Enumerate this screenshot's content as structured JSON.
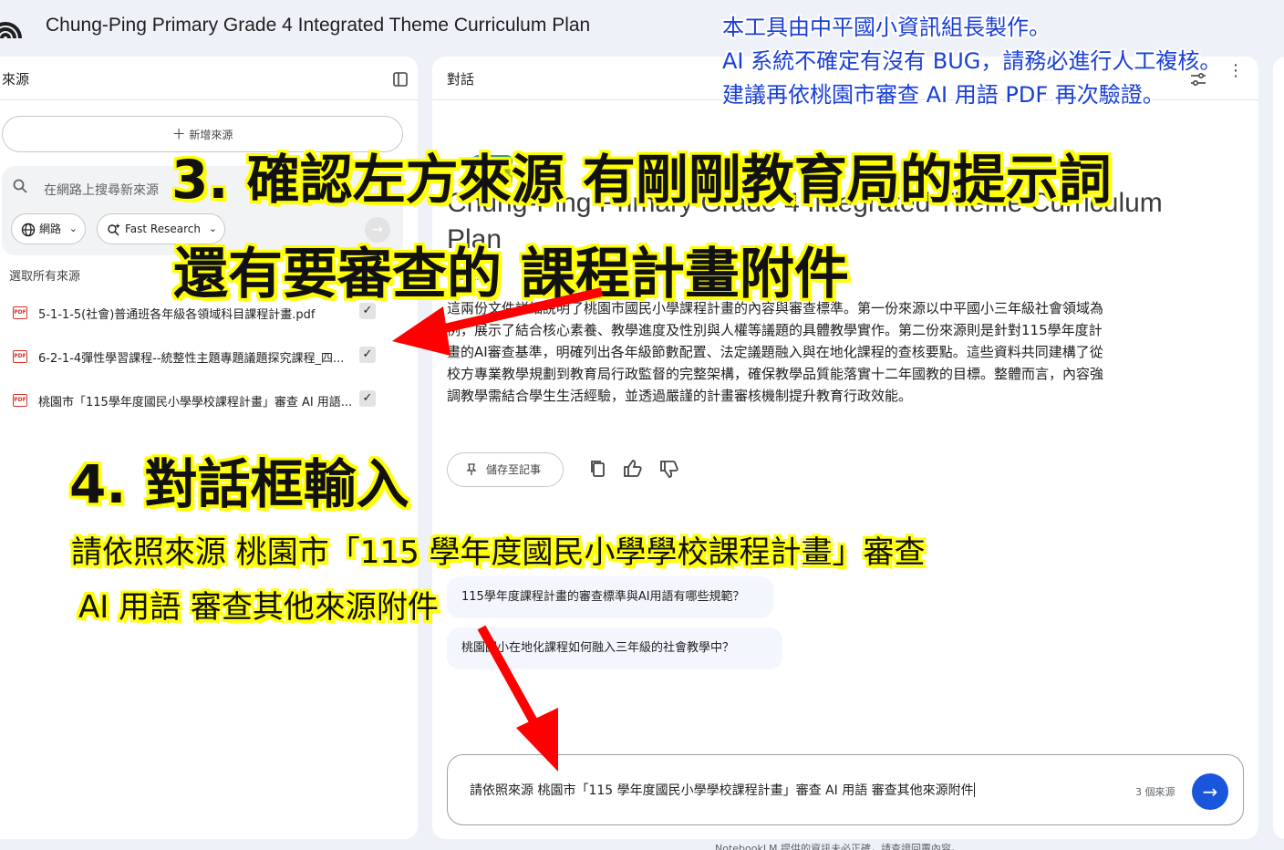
{
  "app": {
    "title": "Chung-Ping Primary Grade 4 Integrated Theme Curriculum Plan"
  },
  "note": {
    "lines": [
      "本工具由中平國小資訊組長製作。",
      "AI 系統不確定有沒有 BUG，請務必進行人工複核。",
      "建議再依桃園市審查 AI 用語 PDF 再次驗證。"
    ]
  },
  "sources_panel": {
    "title": "來源",
    "add_label": "新增來源",
    "search_placeholder": "在網路上搜尋新來源",
    "chip_web": "網路",
    "chip_research": "Fast Research",
    "select_all": "選取所有來源",
    "items": [
      {
        "name": "5-1-1-5(社會)普通班各年級各領域科目課程計畫.pdf",
        "checked": true
      },
      {
        "name": "6-2-1-4彈性學習課程--統整性主題專題議題探究課程_四...",
        "checked": true
      },
      {
        "name": "桃園市「115學年度國民小學學校課程計畫」審查 AI 用語...",
        "checked": true
      }
    ]
  },
  "chat_panel": {
    "title": "對話",
    "doc_title_line1": "Chung-Ping Primary Grade 4 Integrated Theme Curriculum",
    "doc_title_line2": "Plan",
    "source_count": "3 個來源",
    "summary": "這兩份文件詳細說明了桃園市國民小學課程計畫的內容與審查標準。第一份來源以中平國小三年級社會領域為例，展示了結合核心素養、教學進度及性別與人權等議題的具體教學實作。第二份來源則是針對115學年度計畫的AI審查基準，明確列出各年級節數配置、法定議題融入與在地化課程的查核要點。這些資料共同建構了從校方專業教學規劃到教育局行政監督的完整架構，確保教學品質能落實十二年國教的目標。整體而言，內容強調教學需結合學生生活經驗，並透過嚴謹的計畫審核機制提升教育行政效能。",
    "save_label": "儲存至記事",
    "suggestions": [
      "115學年度課程計畫的審查標準與AI用語有哪些規範？",
      "桃園國小在地化課程如何融入三年級的社會教學中？"
    ],
    "input_value": "請依照來源 桃園市「115 學年度國民小學學校課程計畫」審查 AI 用語 審查其他來源附件",
    "input_source_count": "3 個來源",
    "disclaimer": "NotebookLM 提供的資訊未必正確，請查證回覆內容。"
  },
  "annotations": {
    "step3_line1": "3. 確認左方來源 有剛剛教育局的提示詞",
    "step3_line2": "還有要審查的 課程計畫附件",
    "step4_title": "4. 對話框輸入",
    "step4_line1": "請依照來源 桃園市「115 學年度國民小學學校課程計畫」審查",
    "step4_line2": "AI 用語 審查其他來源附件"
  },
  "colors": {
    "accent": "#1a56db",
    "highlight": "#ffff00",
    "arrow": "#ff0000",
    "note_text": "#1a3fd6"
  }
}
